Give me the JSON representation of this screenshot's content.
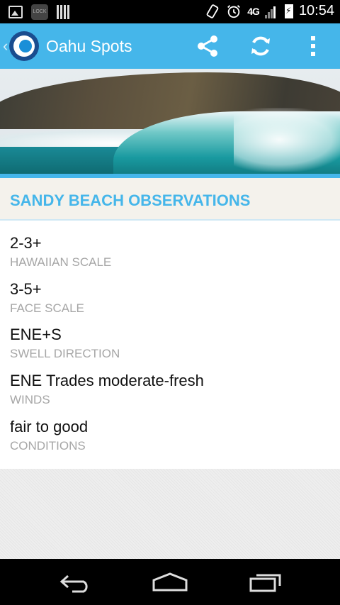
{
  "status_bar": {
    "time": "10:54",
    "network": "4G",
    "lock_icon_text": "LOCK",
    "icons": [
      "image-icon",
      "lock-icon",
      "barcode-icon",
      "vibrate-icon",
      "alarm-icon",
      "signal-icon",
      "battery-charging-icon"
    ]
  },
  "action_bar": {
    "title": "Oahu Spots",
    "background_color": "#45b6ea",
    "actions": [
      "share-icon",
      "refresh-icon",
      "overflow-menu-icon"
    ]
  },
  "section": {
    "title": "SANDY BEACH OBSERVATIONS"
  },
  "observations": [
    {
      "value": "2-3+",
      "label": "HAWAIIAN SCALE"
    },
    {
      "value": "3-5+",
      "label": "FACE SCALE"
    },
    {
      "value": "ENE+S",
      "label": "SWELL DIRECTION"
    },
    {
      "value": "ENE Trades moderate-fresh",
      "label": "WINDS"
    },
    {
      "value": "fair to good",
      "label": "CONDITIONS"
    }
  ],
  "nav_bar": {
    "buttons": [
      "back-icon",
      "home-icon",
      "recent-apps-icon"
    ]
  }
}
